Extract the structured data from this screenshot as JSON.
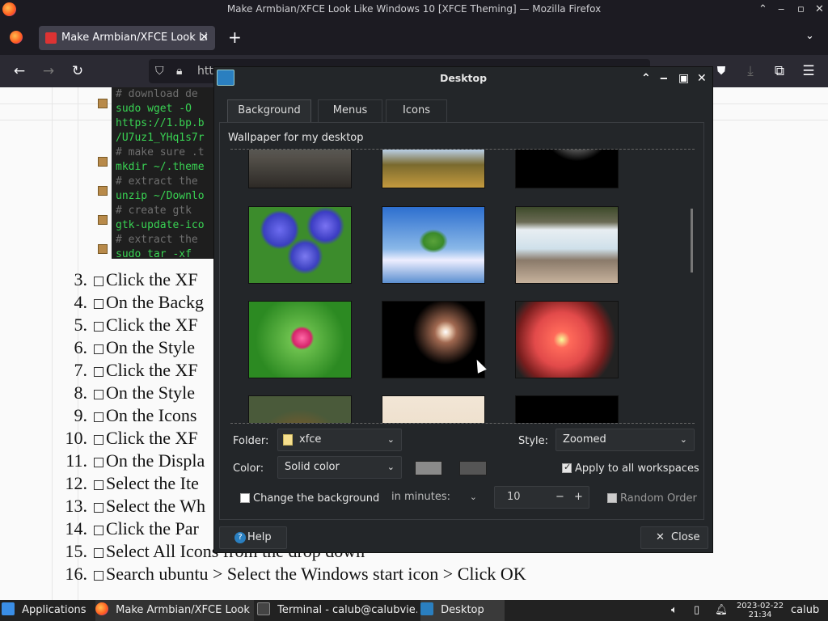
{
  "window": {
    "title": "Make Armbian/XFCE Look Like Windows 10 [XFCE Theming] — Mozilla Firefox"
  },
  "browser": {
    "tab_label": "Make Armbian/XFCE Look Li",
    "new_tab": "+",
    "url_partial": "htt"
  },
  "page": {
    "code_lines": [
      {
        "t": "# download de",
        "c": true
      },
      {
        "t": "sudo wget -O ",
        "c": false
      },
      {
        "t": "https://1.bp.b",
        "c": false
      },
      {
        "t": "/U7uz1_YHq1s7r",
        "c": false
      },
      {
        "t": "# make sure .t",
        "c": true
      },
      {
        "t": "mkdir ~/.theme",
        "c": false
      },
      {
        "t": "# extract the ",
        "c": true
      },
      {
        "t": "unzip ~/Downlo",
        "c": false
      },
      {
        "t": "# create gtk ",
        "c": true
      },
      {
        "t": "gtk-update-ico",
        "c": false
      },
      {
        "t": "# extract the ",
        "c": true
      },
      {
        "t": "sudo tar -xf ",
        "c": false
      }
    ],
    "steps": [
      {
        "num": "3.",
        "text": "Click the XF"
      },
      {
        "num": "4.",
        "text": "On the Backg"
      },
      {
        "num": "5.",
        "text": "Click the XF"
      },
      {
        "num": "6.",
        "text": "On the Style"
      },
      {
        "num": "7.",
        "text": "Click the XF"
      },
      {
        "num": "8.",
        "text": "On the Style"
      },
      {
        "num": "9.",
        "text": "On the Icons"
      },
      {
        "num": "10.",
        "text": "Click the XF"
      },
      {
        "num": "11.",
        "text": "On the Displa"
      },
      {
        "num": "12.",
        "text": "Select the Ite"
      },
      {
        "num": "13.",
        "text": "Select the Wh"
      },
      {
        "num": "14.",
        "text": "Click the Par"
      },
      {
        "num": "15.",
        "text": "Select All Icons from the drop down"
      },
      {
        "num": "16.",
        "text": "Search ubuntu > Select the Windows start icon > Click OK"
      }
    ]
  },
  "dialog": {
    "title": "Desktop",
    "tabs": [
      "Background",
      "Menus",
      "Icons"
    ],
    "wallpaper_label": "Wallpaper for my desktop",
    "folder_label": "Folder:",
    "folder_value": "xfce",
    "style_label": "Style:",
    "style_value": "Zoomed",
    "color_label": "Color:",
    "color_value": "Solid color",
    "apply_all_label": "Apply to all workspaces",
    "apply_all_checked": true,
    "change_bg_label": "Change the background",
    "change_bg_checked": false,
    "interval_unit": "in minutes:",
    "interval_value": "10",
    "random_label": "Random Order",
    "random_checked": false,
    "help_label": "Help",
    "close_label": "Close",
    "color1": "#8a8a8a",
    "color2": "#555555"
  },
  "taskbar": {
    "applications": "Applications",
    "tasks": [
      "Make Armbian/XFCE Look ...",
      "Terminal - calub@calubvie...",
      "Desktop"
    ],
    "date": "2023-02-22",
    "time": "21:34",
    "user": "calub"
  }
}
